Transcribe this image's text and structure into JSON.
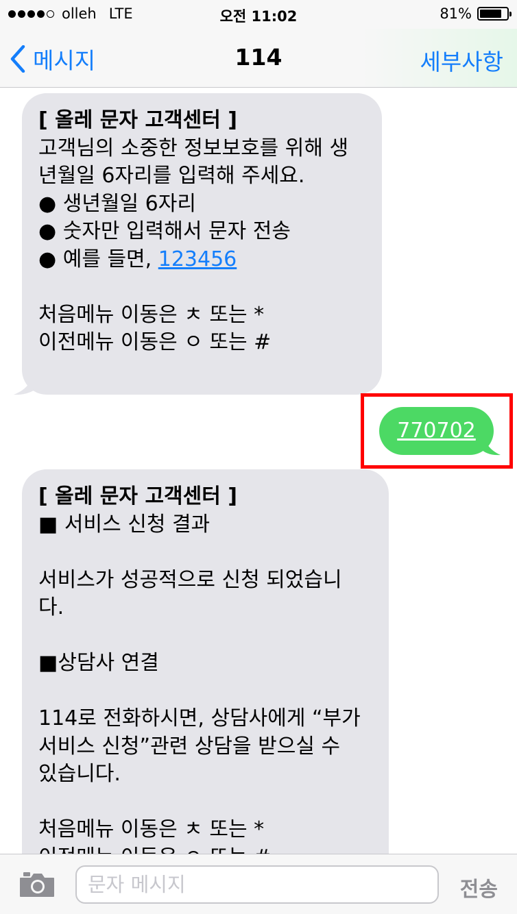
{
  "status_bar": {
    "carrier": "olleh",
    "network": "LTE",
    "time": "오전 11:02",
    "battery": "81%",
    "battery_level": 0.81,
    "signal_bars": 4
  },
  "nav": {
    "back_label": "메시지",
    "title": "114",
    "details_label": "세부사항"
  },
  "messages": {
    "first": {
      "lines": [
        "[ 올레 문자 고객센터 ]",
        "고객님의 소중한 정보보호를 위해 생",
        "년월일 6자리를 입력해 주세요.",
        "● 생년월일 6자리",
        "● 숫자만 입력해서 문자 전송",
        "● 예를 들면, ",
        "",
        "처음메뉴 이동은 ㅊ 또는 *",
        "이전메뉴 이동은 ㅇ 또는 #"
      ],
      "example_link": "123456"
    },
    "sent": {
      "text": "770702"
    },
    "second": {
      "lines": [
        "[ 올레 문자 고객센터 ]",
        "■ 서비스 신청 결과",
        "",
        "서비스가 성공적으로 신청 되었습니",
        "다.",
        "",
        "■상담사 연결",
        "",
        "114로 전화하시면, 상담사에게 “부가",
        "서비스 신청”관련 상담을 받으실 수",
        "있습니다.",
        "",
        "처음메뉴 이동은 ㅊ 또는 *",
        "이전메뉴 이동은 ㅇ 또는 #"
      ]
    }
  },
  "input_bar": {
    "placeholder": "문자 메시지",
    "send_label": "전송"
  },
  "colors": {
    "accent": "#147efb",
    "incoming_bubble": "#e5e5ea",
    "outgoing_bubble": "#4cd964",
    "highlight": "#ff0000"
  },
  "icons": {
    "back": "chevron-left-icon",
    "camera": "camera-icon"
  }
}
